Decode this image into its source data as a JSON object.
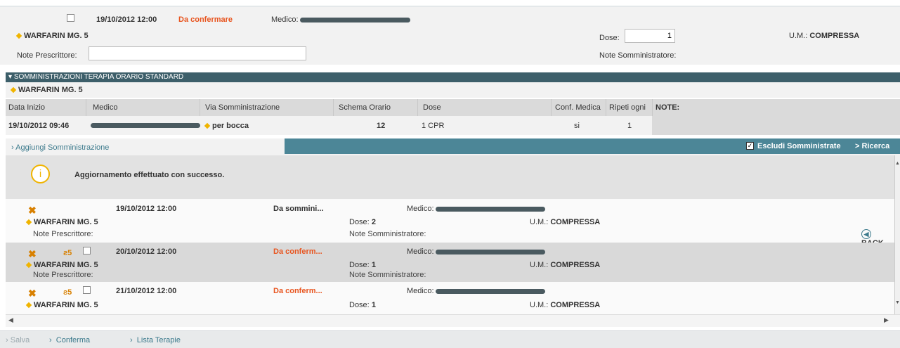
{
  "top_entry": {
    "datetime": "19/10/2012 12:00",
    "status": "Da confermare",
    "medico_label": "Medico:",
    "drug": "WARFARIN MG. 5",
    "note_prescrittore_label": "Note Prescrittore:",
    "dose_label": "Dose:",
    "dose_value": "1",
    "um_label": "U.M.:",
    "um_value": "COMPRESSA",
    "note_somministratore_label": "Note Somministratore:"
  },
  "section": {
    "title": "SOMMINISTRAZIONI TERAPIA ORARIO STANDARD",
    "drug": "WARFARIN MG. 5"
  },
  "table": {
    "headers": [
      "Data Inizio",
      "Medico",
      "Via Somministrazione",
      "Schema Orario",
      "Dose",
      "Conf. Medica",
      "Ripeti ogni",
      "NOTE:"
    ],
    "row": {
      "data_inizio": "19/10/2012 09:46",
      "via": "per bocca",
      "schema": "12",
      "dose": "1 CPR",
      "conf": "si",
      "ripeti": "1"
    }
  },
  "actions": {
    "add": "Aggiungi Somministrazione",
    "exclude": "Escludi Somministrate",
    "search": "> Ricerca"
  },
  "message": "Aggiornamento effettuato con successo.",
  "list": {
    "medico_label": "Medico:",
    "dose_label": "Dose:",
    "um_label": "U.M.:",
    "note_prescrittore_label": "Note Prescrittore:",
    "note_somministratore_label": "Note Somministratore:",
    "back_label": "BACK",
    "items": [
      {
        "datetime": "19/10/2012 12:00",
        "status": "Da sommini...",
        "drug": "WARFARIN MG. 5",
        "dose": "2",
        "um": "COMPRESSA"
      },
      {
        "datetime": "20/10/2012 12:00",
        "status": "Da conferm...",
        "drug": "WARFARIN MG. 5",
        "dose": "1",
        "um": "COMPRESSA"
      },
      {
        "datetime": "21/10/2012 12:00",
        "status": "Da conferm...",
        "drug": "WARFARIN MG. 5",
        "dose": "1",
        "um": "COMPRESSA"
      }
    ]
  },
  "footer": {
    "salva": "Salva",
    "conferma": "Conferma",
    "lista": "Lista Terapie"
  },
  "colors": {
    "header_bg": "#3d5f6a",
    "teal_bar": "#4c8697",
    "status_orange": "#e8541e",
    "icon_orange": "#d88000"
  }
}
